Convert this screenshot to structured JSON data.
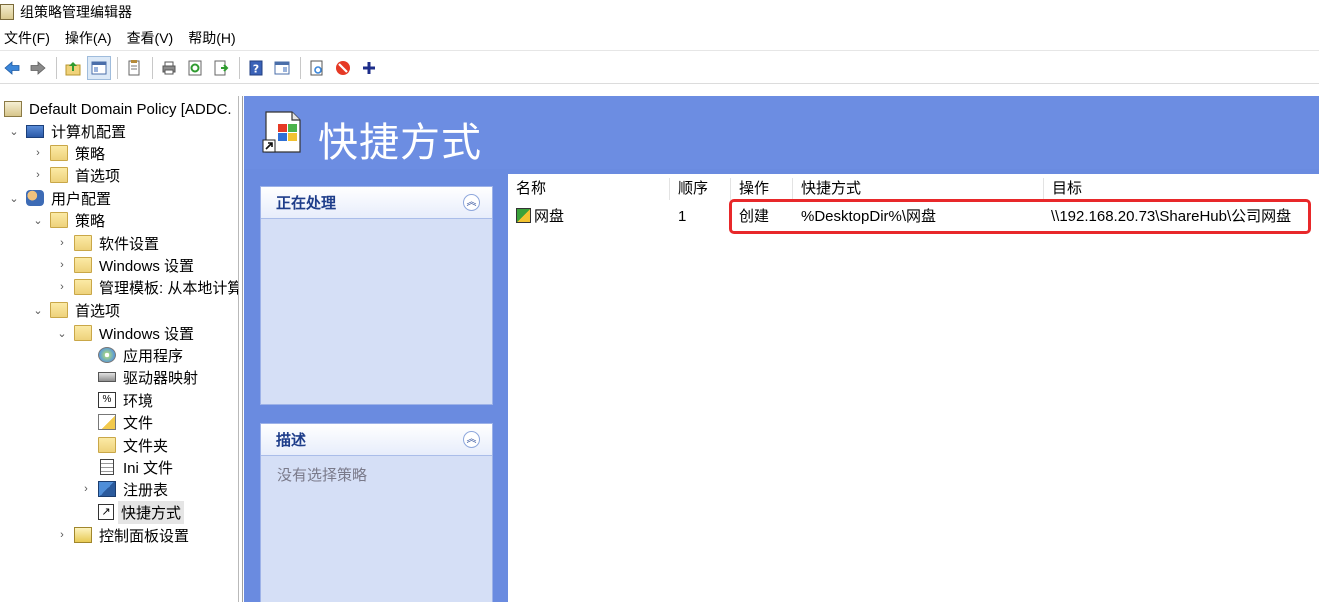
{
  "window": {
    "title": "组策略管理编辑器"
  },
  "menu": [
    "文件(F)",
    "操作(A)",
    "查看(V)",
    "帮助(H)"
  ],
  "toolbar": {
    "buttons": [
      "back-icon",
      "forward-icon",
      "up-folder-icon",
      "show-hide-tree-icon",
      "properties-icon",
      "print-icon",
      "refresh-icon",
      "export-icon",
      "help-icon",
      "show-hide-action-icon",
      "new-doc-icon",
      "stop-icon",
      "add-icon"
    ]
  },
  "tree": {
    "root": "Default Domain Policy [ADDC.",
    "computer_config": "计算机配置",
    "policy": "策略",
    "preferences": "首选项",
    "user_config": "用户配置",
    "software_settings": "软件设置",
    "windows_settings": "Windows 设置",
    "admin_templates": "管理模板: 从本地计算",
    "applications": "应用程序",
    "drive_maps": "驱动器映射",
    "environment": "环境",
    "files": "文件",
    "folders": "文件夹",
    "ini_files": "Ini 文件",
    "registry": "注册表",
    "shortcuts": "快捷方式",
    "control_panel": "控制面板设置"
  },
  "header": {
    "title": "快捷方式"
  },
  "panels": {
    "processing": {
      "title": "正在处理"
    },
    "description": {
      "title": "描述",
      "text": "没有选择策略"
    }
  },
  "columns": [
    "名称",
    "顺序",
    "操作",
    "快捷方式",
    "目标"
  ],
  "rows": [
    {
      "name": "网盘",
      "order": "1",
      "action": "创建",
      "shortcut": "%DesktopDir%\\网盘",
      "target": "\\\\192.168.20.73\\ShareHub\\公司网盘"
    }
  ],
  "colors": {
    "header_blue": "#6c8de2",
    "panel_bg": "#d5dff6",
    "highlight_red": "#e8282a"
  }
}
